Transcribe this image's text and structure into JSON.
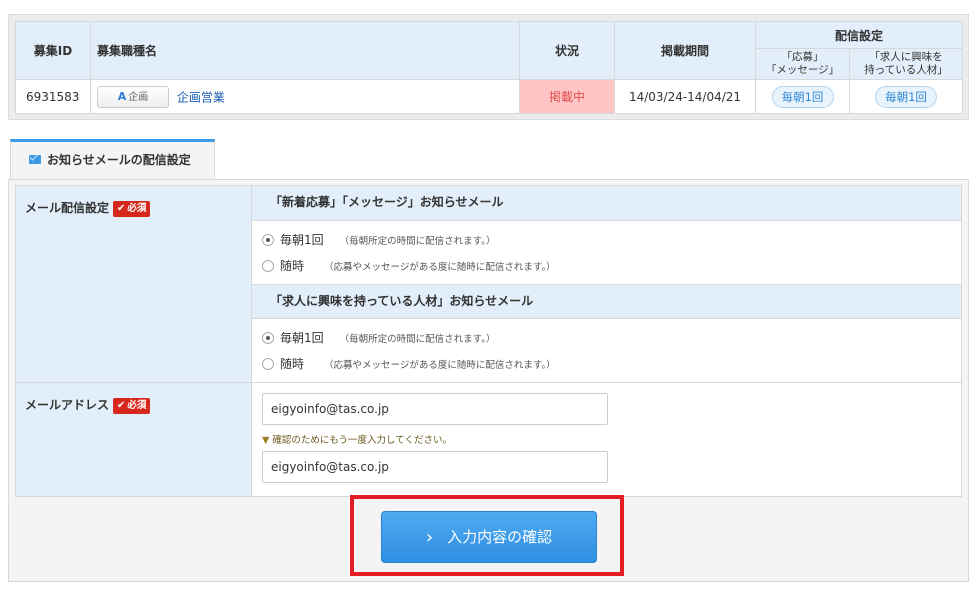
{
  "job_table": {
    "headers": {
      "id": "募集ID",
      "name": "募集職種名",
      "status": "状況",
      "period": "掲載期間",
      "delivery": "配信設定",
      "delivery_sub1": "「応募」\n「メッセージ」",
      "delivery_sub1_line1": "「応募」",
      "delivery_sub1_line2": "「メッセージ」",
      "delivery_sub2_line1": "「求人に興味を",
      "delivery_sub2_line2": "持っている人材」"
    },
    "row": {
      "id": "6931583",
      "tag_letter": "A",
      "tag_text": "企画",
      "job_name": "企画営業",
      "status": "掲載中",
      "period": "14/03/24-14/04/21",
      "delivery1": "毎朝1回",
      "delivery2": "毎朝1回"
    }
  },
  "tab": {
    "label": "お知らせメールの配信設定",
    "icon": "mail-icon"
  },
  "form": {
    "required_label": "必須",
    "mail_setting": {
      "label": "メール配信設定",
      "section1_title": "「新着応募」「メッセージ」お知らせメール",
      "section2_title": "「求人に興味を持っている人材」お知らせメール",
      "option_daily": "毎朝1回",
      "option_daily_note": "（毎朝所定の時間に配信されます。）",
      "option_anytime": "随時",
      "option_anytime_note": "（応募やメッセージがある度に随時に配信されます。）"
    },
    "mail_address": {
      "label": "メールアドレス",
      "value": "eigyoinfo@tas.co.jp",
      "confirm_note": "確認のためにもう一度入力してください。",
      "confirm_value": "eigyoinfo@tas.co.jp"
    }
  },
  "submit": {
    "label": "入力内容の確認"
  },
  "colors": {
    "accent": "#3b9ae6",
    "header_bg": "#e2eef9",
    "status_bg": "#ffc5c5",
    "required": "#d6271c",
    "highlight_frame": "#e41c23"
  }
}
